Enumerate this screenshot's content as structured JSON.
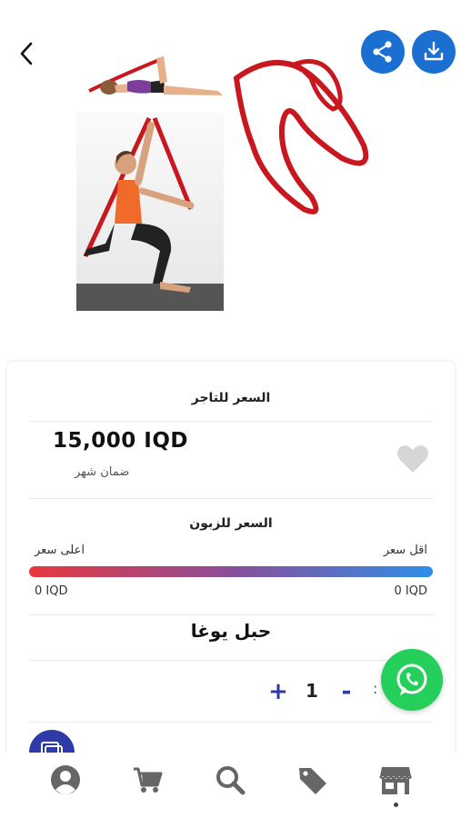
{
  "header": {
    "back_icon": "chevron-left-icon",
    "share_icon": "share-icon",
    "download_icon": "download-icon",
    "accent_color": "#1a6fd1"
  },
  "product": {
    "image": "yoga strap product photo",
    "name": "حبل يوغا"
  },
  "merchant": {
    "title": "السعر للتاجر",
    "price": "15,000 IQD",
    "warranty": "ضمان شهر",
    "favorite_icon": "heart-icon"
  },
  "customer": {
    "title": "السعر للزبون",
    "highest_label": "اعلى سعر",
    "lowest_label": "اقل سعر",
    "min_value": "0 IQD",
    "max_value": "0 IQD",
    "gradient_start": "#e8383d",
    "gradient_end": "#2f8ee8"
  },
  "quantity": {
    "plus_label": "+",
    "minus_label": "-",
    "value": "1",
    "colon": ":"
  },
  "whatsapp": {
    "icon": "whatsapp-icon",
    "color": "#25cf5b"
  },
  "bottom_nav": {
    "items": [
      "profile-icon",
      "cart-icon",
      "search-icon",
      "tag-icon",
      "store-icon"
    ],
    "active": "store-icon"
  }
}
